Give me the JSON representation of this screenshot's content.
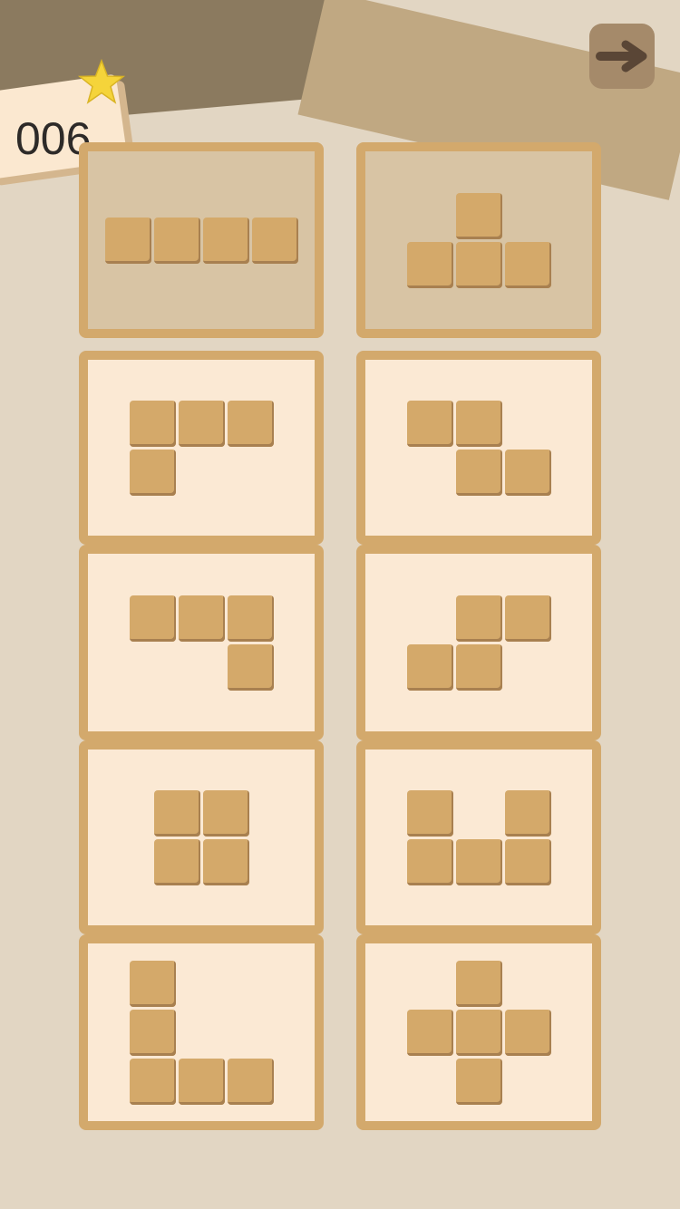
{
  "header": {
    "level_number": "006",
    "star_icon": "star-icon",
    "next_icon": "arrow-right-icon"
  },
  "colors": {
    "background": "#e2d6c3",
    "card_border": "#d3a96c",
    "card_fill": "#fbe9d4",
    "card_fill_used": "#d8c4a4",
    "block": "#d4a96a",
    "star": "#f5d43a"
  },
  "pieces": [
    {
      "id": "I",
      "state": "used",
      "cells": [
        [
          0,
          0
        ],
        [
          1,
          0
        ],
        [
          2,
          0
        ],
        [
          3,
          0
        ]
      ]
    },
    {
      "id": "T",
      "state": "used",
      "cells": [
        [
          1,
          0
        ],
        [
          0,
          1
        ],
        [
          1,
          1
        ],
        [
          2,
          1
        ]
      ]
    },
    {
      "id": "L3",
      "state": "available",
      "cells": [
        [
          0,
          0
        ],
        [
          1,
          0
        ],
        [
          2,
          0
        ],
        [
          0,
          1
        ]
      ]
    },
    {
      "id": "Z",
      "state": "available",
      "cells": [
        [
          0,
          0
        ],
        [
          1,
          0
        ],
        [
          1,
          1
        ],
        [
          2,
          1
        ]
      ]
    },
    {
      "id": "J3",
      "state": "available",
      "cells": [
        [
          0,
          0
        ],
        [
          1,
          0
        ],
        [
          2,
          0
        ],
        [
          2,
          1
        ]
      ]
    },
    {
      "id": "S",
      "state": "available",
      "cells": [
        [
          1,
          0
        ],
        [
          2,
          0
        ],
        [
          0,
          1
        ],
        [
          1,
          1
        ]
      ]
    },
    {
      "id": "O",
      "state": "available",
      "cells": [
        [
          0,
          0
        ],
        [
          1,
          0
        ],
        [
          0,
          1
        ],
        [
          1,
          1
        ]
      ]
    },
    {
      "id": "U",
      "state": "available",
      "cells": [
        [
          0,
          0
        ],
        [
          2,
          0
        ],
        [
          0,
          1
        ],
        [
          1,
          1
        ],
        [
          2,
          1
        ]
      ]
    },
    {
      "id": "V",
      "state": "available",
      "cells": [
        [
          0,
          0
        ],
        [
          0,
          1
        ],
        [
          0,
          2
        ],
        [
          1,
          2
        ],
        [
          2,
          2
        ]
      ]
    },
    {
      "id": "X",
      "state": "available",
      "cells": [
        [
          1,
          0
        ],
        [
          0,
          1
        ],
        [
          1,
          1
        ],
        [
          2,
          1
        ],
        [
          1,
          2
        ]
      ]
    }
  ]
}
